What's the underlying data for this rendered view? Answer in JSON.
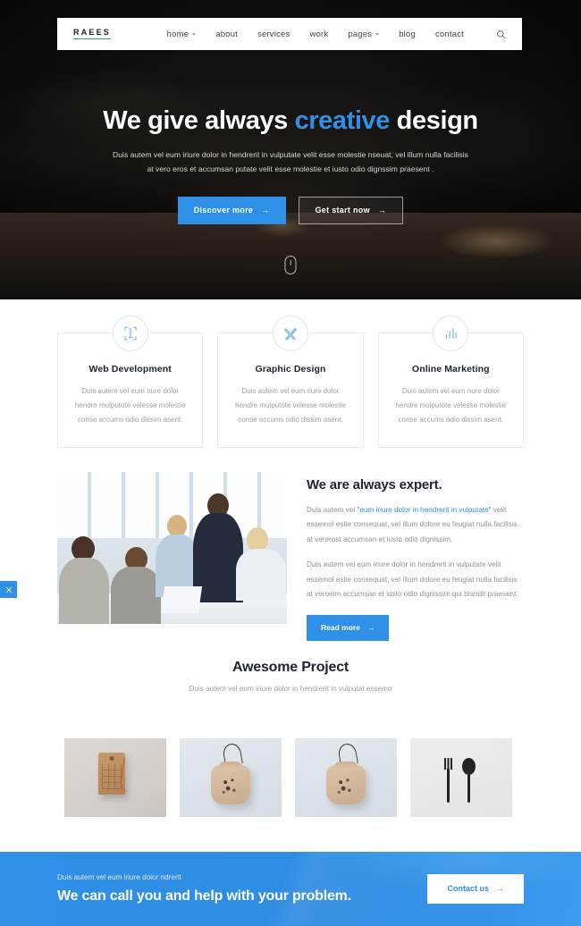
{
  "navbar": {
    "logo": "RAEES",
    "links": [
      {
        "label": "home",
        "has_dropdown": true
      },
      {
        "label": "about",
        "has_dropdown": false
      },
      {
        "label": "services",
        "has_dropdown": false
      },
      {
        "label": "work",
        "has_dropdown": false
      },
      {
        "label": "pages",
        "has_dropdown": true
      },
      {
        "label": "blog",
        "has_dropdown": false
      },
      {
        "label": "contact",
        "has_dropdown": false
      }
    ],
    "search_icon": "search-icon"
  },
  "hero": {
    "title_part1": "We give always ",
    "title_accent": "creative",
    "title_part2": " design",
    "subtitle_line1": "Duis autem vel eum iriure dolor in hendrerit in vulputate velit esse molestie nseuat, vel illum nulla facilisis",
    "subtitle_line2": "at vero eros et accumsan putate velit esse molestie et iusto odio dignssim praesent .",
    "primary_button": "Discover more",
    "secondary_button": "Get start now",
    "arrow": "→",
    "scroll_icon": "mouse-scroll-icon"
  },
  "services": {
    "cards": [
      {
        "icon": "code-monitor-icon",
        "title": "Web Development",
        "desc_line1": "Duis autem vel eum nure dolor",
        "desc_line2": "hendre mulputote velesse molestie",
        "desc_line3": "conse accums odio dissim asent."
      },
      {
        "icon": "pencil-ruler-icon",
        "title": "Graphic Design",
        "desc_line1": "Duis autem vel eum nure dolor",
        "desc_line2": "hendre mulputote velesse molestie",
        "desc_line3": "conse accums odio dissim asent."
      },
      {
        "icon": "bar-chart-icon",
        "title": "Online Marketing",
        "desc_line1": "Duis autem vel eum nure dolor",
        "desc_line2": "hendre mulputote velesse molestie",
        "desc_line3": "conse accums odio dissim asent."
      }
    ]
  },
  "expert": {
    "image_alt": "business-team-meeting-photo",
    "title": "We are always expert.",
    "para1_before": "Duis autem vel ",
    "para1_highlight": "\"eum iriure dolor in hendrerit in vulputate\"",
    "para1_after": " velit essemol estie consequat, vel illum dolore eu feugiat nulla facilisis at vererost accumsan et iusto odio dignissim.",
    "para2": "Duis autem vel eum iriure dolor in hendrerit in vulputate velit essemol estie consequat, vel illum dolore eu feugiat nulla facilisis at veroeim accumsan et iusto odio dignissim qui blandit praesent.",
    "button": "Read more",
    "arrow": "→"
  },
  "projects": {
    "title": "Awesome Project",
    "subtitle": "Duis autem vel eum iriure dolor in hendrerit in vulputat essemo",
    "items": [
      {
        "name": "hang-tag-mockup"
      },
      {
        "name": "drawstring-pouch-mockup-1"
      },
      {
        "name": "drawstring-pouch-mockup-2"
      },
      {
        "name": "cutlery-mockup"
      }
    ]
  },
  "cta": {
    "small_text": "Duis autem vel eum iriure dolor ndrerit",
    "title": "We can call you and help with your problem.",
    "button": "Contact us",
    "arrow": "→"
  },
  "side_tab": {
    "icon": "close-icon",
    "label": "×"
  },
  "colors": {
    "accent_blue": "#2f90e8",
    "cta_blue": "#3090e6",
    "heading_dark": "#1d2430",
    "body_gray": "#9aa0a8"
  }
}
